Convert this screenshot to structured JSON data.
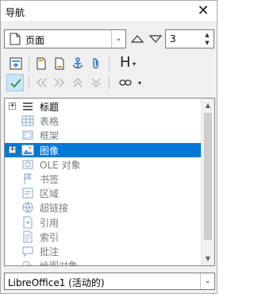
{
  "window": {
    "title": "导航",
    "close_glyph": "✕"
  },
  "navigate_by": {
    "value": "页面",
    "icon": "page-icon",
    "arrow": "⌄"
  },
  "page_spin": {
    "value": "3",
    "up": "▲",
    "down": "▼"
  },
  "toolbar": {
    "heading_letter": "H",
    "dropdown_glyph": "▾"
  },
  "tree": {
    "items": [
      {
        "label": "标题",
        "expander": "+",
        "icon": "headings-icon",
        "dim": false,
        "selected": false
      },
      {
        "label": "表格",
        "expander": "",
        "icon": "table-icon",
        "dim": true,
        "selected": false
      },
      {
        "label": "框架",
        "expander": "",
        "icon": "frame-icon",
        "dim": true,
        "selected": false
      },
      {
        "label": "图像",
        "expander": "+",
        "icon": "image-icon",
        "dim": false,
        "selected": true
      },
      {
        "label": "OLE 对象",
        "expander": "",
        "icon": "ole-object-icon",
        "dim": true,
        "selected": false
      },
      {
        "label": "书签",
        "expander": "",
        "icon": "bookmark-icon",
        "dim": true,
        "selected": false
      },
      {
        "label": "区域",
        "expander": "",
        "icon": "section-icon",
        "dim": true,
        "selected": false
      },
      {
        "label": "超链接",
        "expander": "",
        "icon": "hyperlink-icon",
        "dim": true,
        "selected": false
      },
      {
        "label": "引用",
        "expander": "",
        "icon": "reference-icon",
        "dim": true,
        "selected": false
      },
      {
        "label": "索引",
        "expander": "",
        "icon": "index-icon",
        "dim": true,
        "selected": false
      },
      {
        "label": "批注",
        "expander": "",
        "icon": "comment-icon",
        "dim": true,
        "selected": false
      },
      {
        "label": "绘图对象",
        "expander": "",
        "icon": "drawing-object-icon",
        "dim": true,
        "selected": false
      }
    ],
    "scroll_up": "▲",
    "scroll_down": "▼"
  },
  "document_select": {
    "value": "LibreOffice1 (活动的)",
    "arrow": "⌄"
  },
  "colors": {
    "selection": "#0078d7",
    "accent_blue": "#1e6fc4",
    "check_green": "#2e9a4a"
  }
}
